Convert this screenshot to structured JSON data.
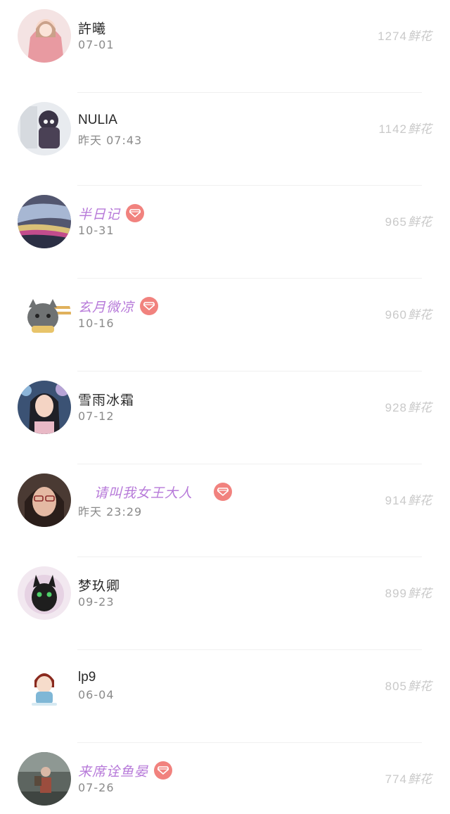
{
  "flower_unit": "鲜花",
  "rows": [
    {
      "name": "許曦",
      "time": "07-01",
      "score": "1274",
      "vip": false
    },
    {
      "name": "NULIA",
      "time": "昨天 07:43",
      "score": "1142",
      "vip": false
    },
    {
      "name": "半日记",
      "time": "10-31",
      "score": "965",
      "vip": true
    },
    {
      "name": "玄月微凉",
      "time": "10-16",
      "score": "960",
      "vip": true
    },
    {
      "name": "雪雨冰霜",
      "time": "07-12",
      "score": "928",
      "vip": false
    },
    {
      "name": "请叫我女王大人",
      "time": "昨天 23:29",
      "score": "914",
      "vip": true
    },
    {
      "name": "梦玖卿",
      "time": "09-23",
      "score": "899",
      "vip": false
    },
    {
      "name": "lp9",
      "time": "06-04",
      "score": "805",
      "vip": false
    },
    {
      "name": "来席诠鱼晏",
      "time": "07-26",
      "score": "774",
      "vip": true
    }
  ],
  "colors": {
    "vip_name": "#b77ad9",
    "vip_badge": "#f1827e",
    "score_text": "#c9c9c9",
    "time_text": "#8a8a8a"
  },
  "icons": {
    "vip": "diamond-icon"
  }
}
